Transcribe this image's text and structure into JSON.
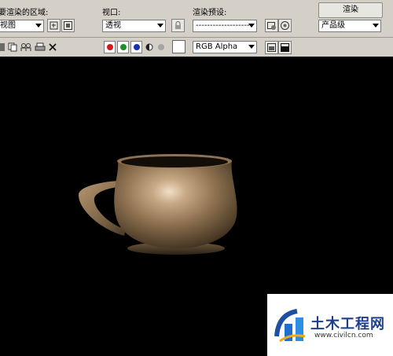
{
  "toolbar": {
    "area_label": "要渲染的区域:",
    "area_value": "视图",
    "viewport_label": "视口:",
    "viewport_value": "透视",
    "preset_label": "渲染预设:",
    "preset_value": "-------------------",
    "render_button": "渲染",
    "quality_value": "产品级",
    "channel_value": "RGB Alpha"
  },
  "colors": {
    "red_channel": "#d21a1a",
    "green_channel": "#1b8f2a",
    "blue_channel": "#1a2fb8"
  },
  "watermark": {
    "title": "土木工程网",
    "url": "www.civilcn.com"
  }
}
